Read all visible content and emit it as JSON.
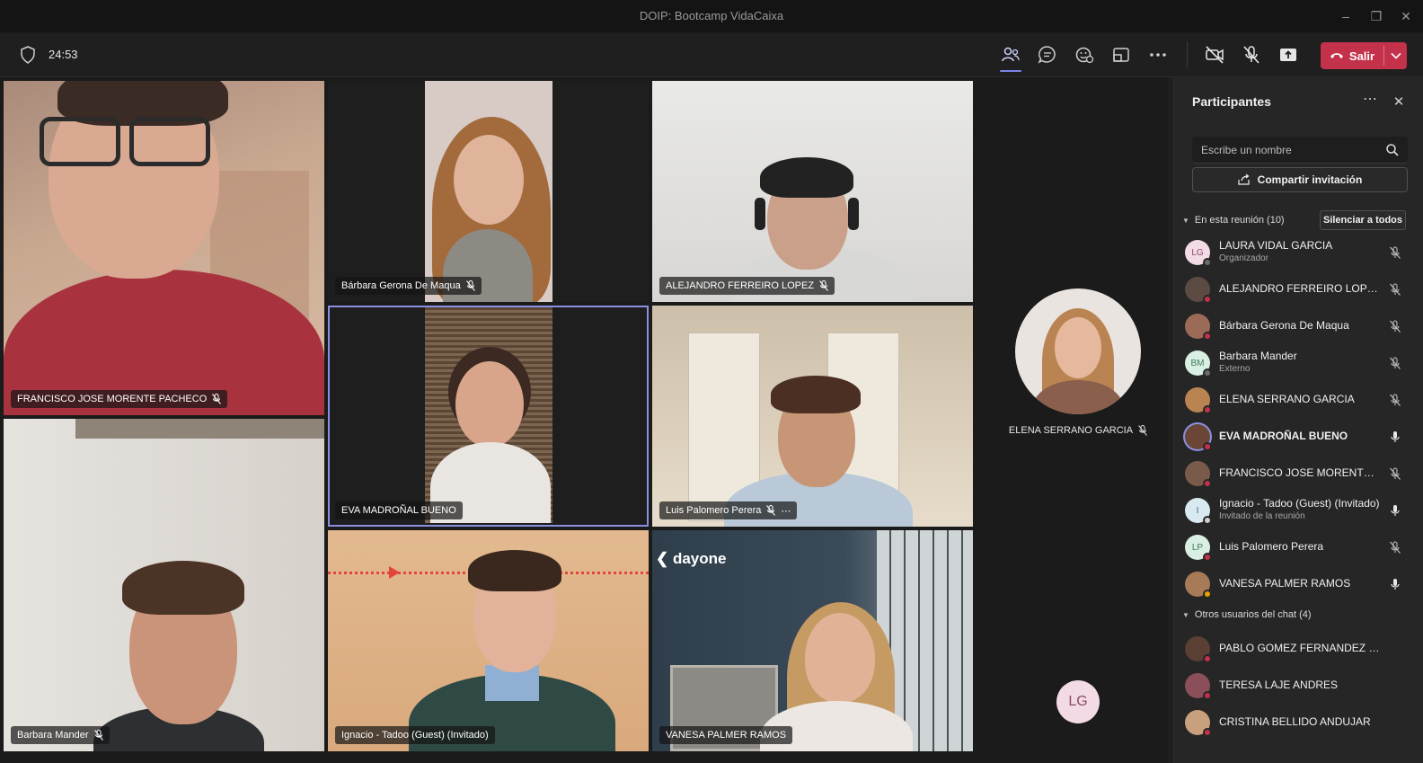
{
  "window": {
    "title": "DOIP: Bootcamp VidaCaixa"
  },
  "toolbar": {
    "timer": "24:53",
    "leave_label": "Salir"
  },
  "tiles": [
    {
      "name": "FRANCISCO JOSE MORENTE PACHECO"
    },
    {
      "name": "Bárbara Gerona De Maqua"
    },
    {
      "name": "ALEJANDRO FERREIRO LOPEZ"
    },
    {
      "name": "EVA MADROÑAL BUENO"
    },
    {
      "name": "Luis Palomero Perera"
    },
    {
      "name": "Barbara Mander"
    },
    {
      "name": "Ignacio - Tadoo (Guest) (Invitado)"
    },
    {
      "name": "VANESA PALMER RAMOS"
    }
  ],
  "dayone_logo": "dayone",
  "side": {
    "featured_name": "ELENA SERRANO GARCIA",
    "initials_avatar": "LG"
  },
  "panel": {
    "title": "Participantes",
    "search_placeholder": "Escribe un nombre",
    "share_invite_label": "Compartir invitación",
    "in_meeting_label": "En esta reunión (10)",
    "mute_all_label": "Silenciar a todos",
    "other_users_label": "Otros usuarios del chat (4)",
    "in_meeting": [
      {
        "name": "LAURA VIDAL GARCIA",
        "role": "Organizador",
        "initials": "LG",
        "mic": "muted"
      },
      {
        "name": "ALEJANDRO FERREIRO LOPEZ",
        "role": "",
        "initials": "",
        "mic": "muted"
      },
      {
        "name": "Bárbara Gerona De Maqua",
        "role": "",
        "initials": "",
        "mic": "muted"
      },
      {
        "name": "Barbara Mander",
        "role": "Externo",
        "initials": "BM",
        "mic": "muted"
      },
      {
        "name": "ELENA SERRANO GARCIA",
        "role": "",
        "initials": "",
        "mic": "muted"
      },
      {
        "name": "EVA MADROÑAL BUENO",
        "role": "",
        "initials": "",
        "mic": "on"
      },
      {
        "name": "FRANCISCO JOSE MORENTE PA...",
        "role": "",
        "initials": "",
        "mic": "muted"
      },
      {
        "name": "Ignacio - Tadoo (Guest) (Invitado)",
        "role": "Invitado de la reunión",
        "initials": "I",
        "mic": "on"
      },
      {
        "name": "Luis Palomero Perera",
        "role": "",
        "initials": "LP",
        "mic": "muted"
      },
      {
        "name": "VANESA PALMER RAMOS",
        "role": "",
        "initials": "",
        "mic": "on"
      }
    ],
    "other_users": [
      {
        "name": "PABLO GOMEZ FERNANDEZ QUINT..."
      },
      {
        "name": "TERESA LAJE ANDRES"
      },
      {
        "name": "CRISTINA BELLIDO ANDUJAR"
      }
    ]
  },
  "colors": {
    "leave_red": "#c4314b",
    "accent": "#7b83eb",
    "status_red": "#c4314b",
    "status_green": "#6bb700"
  }
}
